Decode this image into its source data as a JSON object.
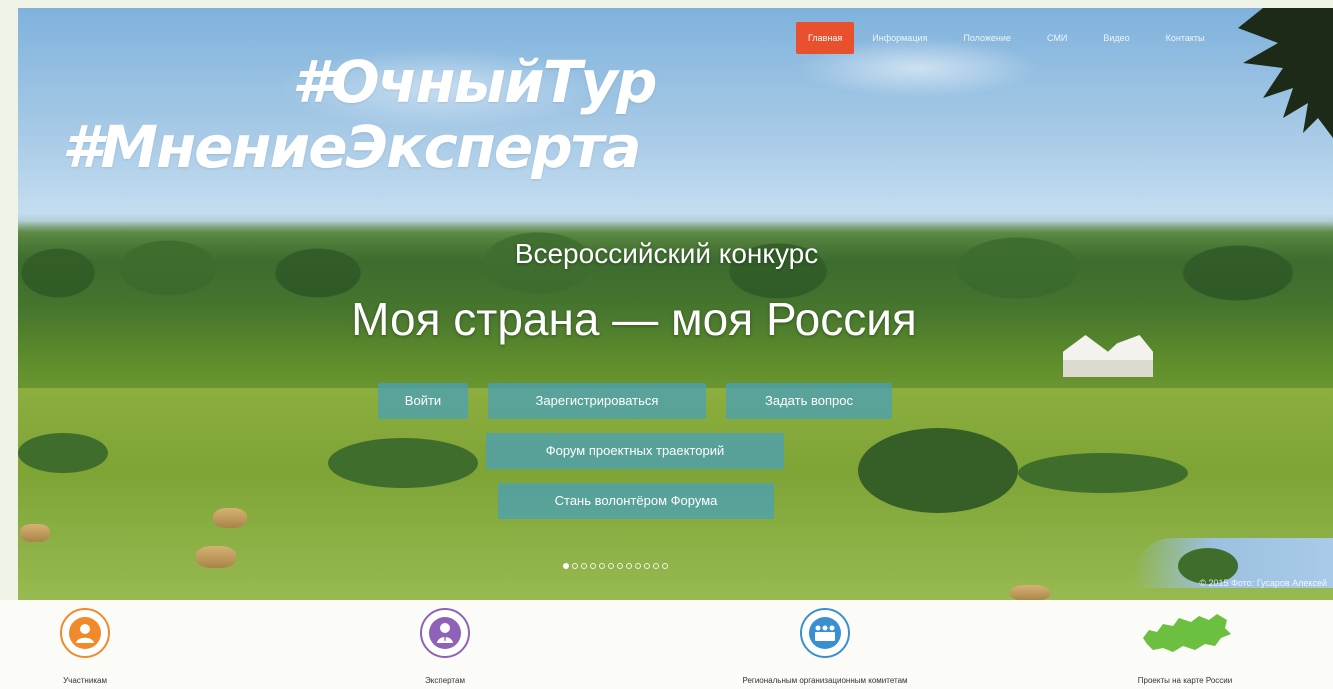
{
  "nav": {
    "items": [
      {
        "label": "Главная",
        "active": true
      },
      {
        "label": "Информация",
        "active": false
      },
      {
        "label": "Положение",
        "active": false
      },
      {
        "label": "СМИ",
        "active": false
      },
      {
        "label": "Видео",
        "active": false
      },
      {
        "label": "Контакты",
        "active": false
      }
    ],
    "accent_color": "#e8502e"
  },
  "hashtags": {
    "line1": "#ОчныйТур",
    "line2": "#МнениеЭксперта"
  },
  "hero": {
    "subtitle": "Всероссийский конкурс",
    "title": "Моя страна — моя Россия",
    "buttons": {
      "login": "Войти",
      "register": "Зарегистрироваться",
      "ask": "Задать вопрос",
      "forum": "Форум проектных траекторий",
      "volunteer": "Стань волонтёром Форума"
    },
    "slider": {
      "total": 12,
      "active_index": 0
    },
    "copyright": "© 2015 Фото: Гусаров Алексей"
  },
  "categories": [
    {
      "label": "Участникам",
      "icon": "participant-icon",
      "color": "#f08a2a"
    },
    {
      "label": "Экспертам",
      "icon": "expert-icon",
      "color": "#8e62b7"
    },
    {
      "label": "Региональным организационным комитетам",
      "icon": "committee-icon",
      "color": "#3a8fd1"
    },
    {
      "label": "Проекты на карте России",
      "icon": "russia-map-icon",
      "color": "#6cbf3f"
    }
  ]
}
